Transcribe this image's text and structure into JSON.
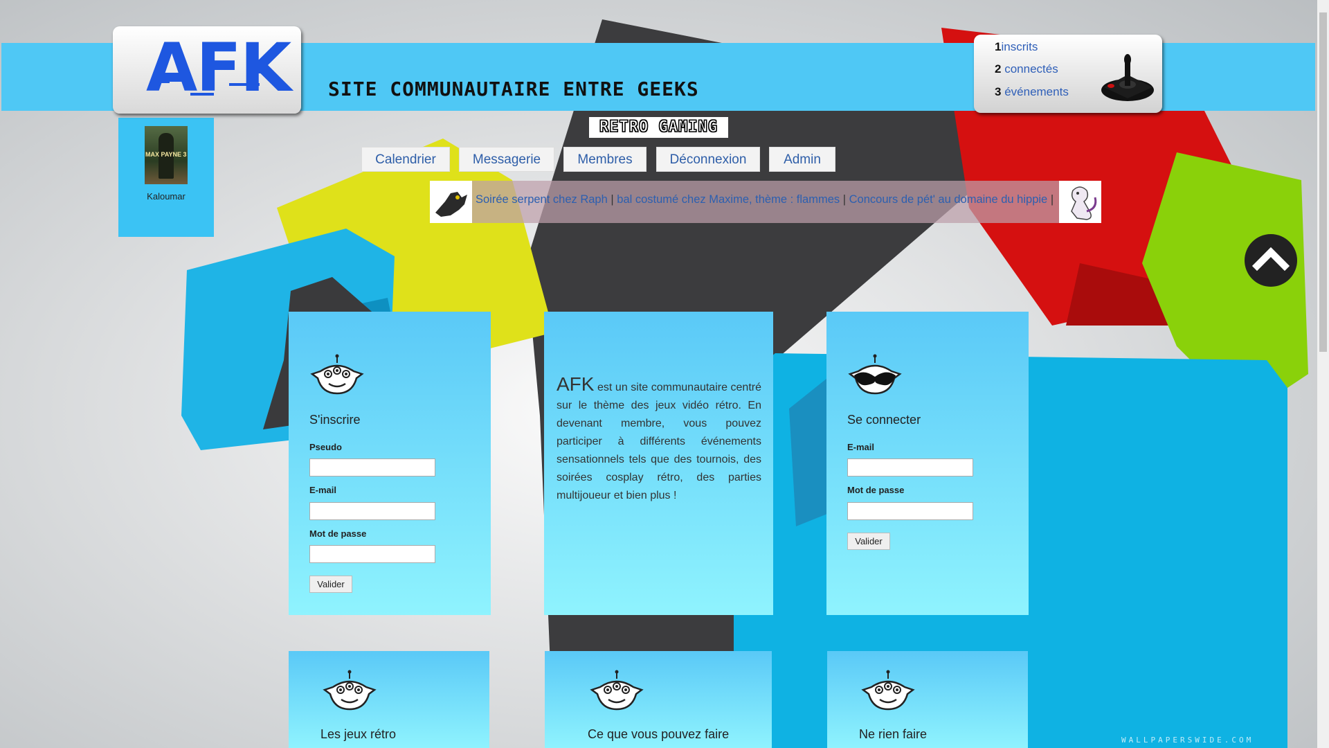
{
  "header": {
    "logo": "AFK",
    "site_title": "SITE COMMUNAUTAIRE ENTRE GEEKS",
    "badge": "RETRO GAMING"
  },
  "stats": [
    {
      "count": "1",
      "label": "inscrits"
    },
    {
      "count": "2",
      "label": "connectés"
    },
    {
      "count": "3",
      "label": "événements"
    }
  ],
  "user": {
    "name": "Kaloumar",
    "avatar_caption": "MAX PAYNE 3"
  },
  "nav": [
    "Calendrier",
    "Messagerie",
    "Membres",
    "Déconnexion",
    "Admin"
  ],
  "ticker": {
    "items": [
      "Soirée serpent chez Raph",
      "bal costumé chez Maxime, thème : flammes",
      "Concours de pét' au domaine du hippie"
    ],
    "separator": "|"
  },
  "register": {
    "title": "S'inscrire",
    "pseudo_label": "Pseudo",
    "email_label": "E-mail",
    "password_label": "Mot de passe",
    "submit": "Valider"
  },
  "about": {
    "lead": "AFK",
    "text": "est un site communautaire centré sur le thème des jeux vidéo rétro. En devenant membre, vous pouvez participer à différents événements sensationnels tels que des tournois, des soirées cosplay rétro, des parties multijoueur et bien plus !"
  },
  "login": {
    "title": "Se connecter",
    "email_label": "E-mail",
    "password_label": "Mot de passe",
    "submit": "Valider"
  },
  "bottom_cards": [
    {
      "title": "Les jeux rétro"
    },
    {
      "title": "Ce que vous pouvez faire"
    },
    {
      "title": "Ne rien faire"
    }
  ],
  "watermark": "WALLPAPERSWIDE.COM",
  "icons": {
    "card": "alien-icon",
    "login": "alien-mustache-icon",
    "stats": "joystick-icon",
    "scroll": "chevron-up-icon"
  },
  "colors": {
    "banner": "#4fc8f5",
    "card_top": "#5ac9f7",
    "card_bottom": "#8ff3fe",
    "link": "#2e5ea8",
    "logo": "#1e57e0"
  }
}
